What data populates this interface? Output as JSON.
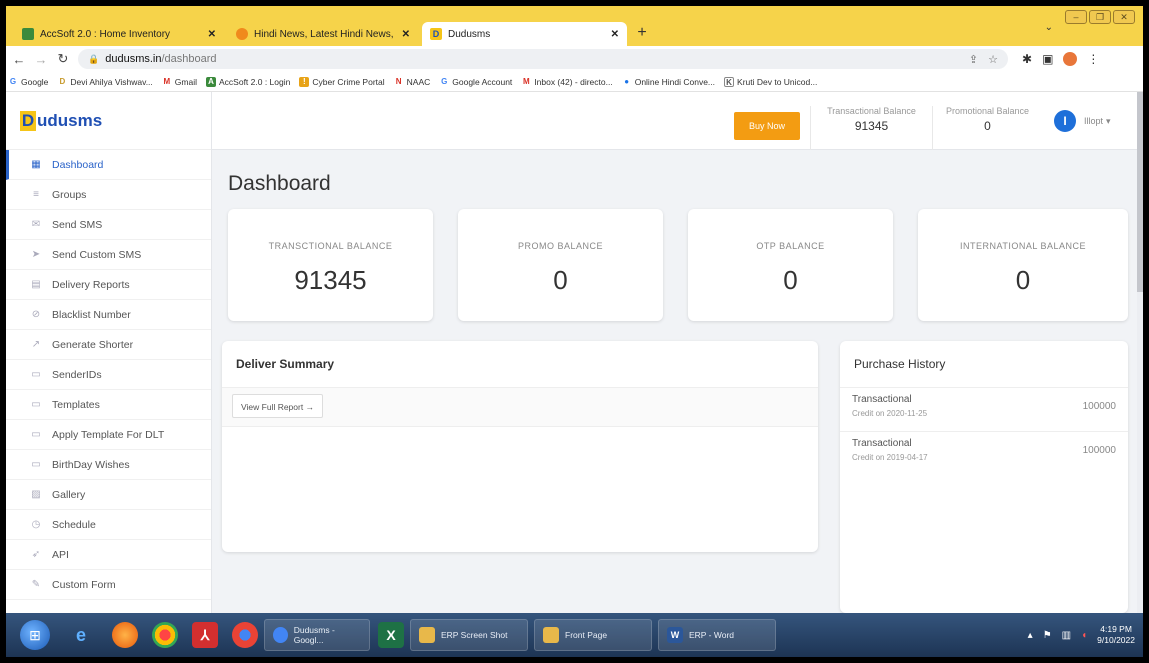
{
  "browser": {
    "tabs": [
      {
        "label": "AccSoft 2.0 : Home Inventory",
        "icon": "accsoft-icon",
        "color": "#3b8a3c"
      },
      {
        "label": "Hindi News, Latest Hindi News, I",
        "icon": "news-icon",
        "color": "#f08a1c"
      },
      {
        "label": "Dudusms",
        "icon": "dudusms-icon",
        "color": "#f5c518"
      }
    ],
    "address": {
      "host": "dudusms.in",
      "path": "/dashboard"
    },
    "bookmarks": [
      {
        "label": "Google",
        "icon": "google-icon",
        "color": "#4285f4",
        "glyph": "G"
      },
      {
        "label": "Devi Ahilya Vishwav...",
        "icon": "university-icon",
        "color": "#c79a2c",
        "glyph": "D"
      },
      {
        "label": "Gmail",
        "icon": "gmail-icon",
        "color": "#d93025",
        "glyph": "M"
      },
      {
        "label": "AccSoft 2.0 : Login",
        "icon": "accsoft-icon",
        "color": "#3b8a3c",
        "glyph": "A"
      },
      {
        "label": "Cyber Crime Portal",
        "icon": "cyber-crime-icon",
        "color": "#e8a317",
        "glyph": "!"
      },
      {
        "label": "NAAC",
        "icon": "naac-icon",
        "color": "#d93025",
        "glyph": "N"
      },
      {
        "label": "Google Account",
        "icon": "google-icon",
        "color": "#4285f4",
        "glyph": "G"
      },
      {
        "label": "Inbox (42) - directo...",
        "icon": "gmail-icon",
        "color": "#d93025",
        "glyph": "M"
      },
      {
        "label": "Online Hindi Conve...",
        "icon": "globe-icon",
        "color": "#1a73e8",
        "glyph": "●"
      },
      {
        "label": "Kruti Dev to Unicod...",
        "icon": "kruti-icon",
        "color": "#555555",
        "glyph": "K"
      }
    ]
  },
  "app": {
    "brand": {
      "letter": "D",
      "name": "udusms"
    },
    "nav": [
      {
        "label": "Dashboard",
        "icon": "dashboard-icon",
        "glyph": "▦"
      },
      {
        "label": "Groups",
        "icon": "groups-icon",
        "glyph": "≡"
      },
      {
        "label": "Send SMS",
        "icon": "envelope-icon",
        "glyph": "✉"
      },
      {
        "label": "Send Custom SMS",
        "icon": "send-icon",
        "glyph": "➤"
      },
      {
        "label": "Delivery Reports",
        "icon": "report-icon",
        "glyph": "▤"
      },
      {
        "label": "Blacklist Number",
        "icon": "ban-icon",
        "glyph": "⊘"
      },
      {
        "label": "Generate Shorter",
        "icon": "link-icon",
        "glyph": "↗"
      },
      {
        "label": "SenderIDs",
        "icon": "id-card-icon",
        "glyph": "▭"
      },
      {
        "label": "Templates",
        "icon": "template-icon",
        "glyph": "▭"
      },
      {
        "label": "Apply Template For DLT",
        "icon": "template-icon",
        "glyph": "▭"
      },
      {
        "label": "BirthDay Wishes",
        "icon": "gift-icon",
        "glyph": "▭"
      },
      {
        "label": "Gallery",
        "icon": "image-icon",
        "glyph": "▨"
      },
      {
        "label": "Schedule",
        "icon": "clock-icon",
        "glyph": "◷"
      },
      {
        "label": "API",
        "icon": "api-icon",
        "glyph": "➶"
      },
      {
        "label": "Custom Form",
        "icon": "form-icon",
        "glyph": "✎"
      }
    ],
    "topbar": {
      "buy_now": "Buy Now",
      "transactional_label": "Transactional Balance",
      "transactional_value": "91345",
      "promotional_label": "Promotional Balance",
      "promotional_value": "0",
      "avatar_letter": "I",
      "username": "Illopt"
    },
    "page_title": "Dashboard",
    "cards": [
      {
        "label": "TRANSCTIONAL BALANCE",
        "value": "91345"
      },
      {
        "label": "PROMO BALANCE",
        "value": "0"
      },
      {
        "label": "OTP BALANCE",
        "value": "0"
      },
      {
        "label": "INTERNATIONAL BALANCE",
        "value": "0"
      }
    ],
    "deliver_summary": {
      "title": "Deliver Summary",
      "button": "View Full Report →"
    },
    "purchase_history": {
      "title": "Purchase History",
      "rows": [
        {
          "type": "Transactional",
          "date": "Credit on 2020-11-25",
          "amount": "100000"
        },
        {
          "type": "Transactional",
          "date": "Credit on 2019-04-17",
          "amount": "100000"
        }
      ]
    }
  },
  "taskbar": {
    "tasks": [
      {
        "label": "Dudusms - Googl...",
        "icon": "chrome-icon",
        "color": "#4285f4"
      },
      {
        "label": "ERP Screen Shot",
        "icon": "folder-icon",
        "color": "#e8b84a"
      },
      {
        "label": "Front Page",
        "icon": "folder-icon",
        "color": "#e8b84a"
      },
      {
        "label": "ERP - Word",
        "icon": "word-icon",
        "color": "#2b579a"
      }
    ],
    "time": "4:19 PM",
    "date": "9/10/2022"
  }
}
